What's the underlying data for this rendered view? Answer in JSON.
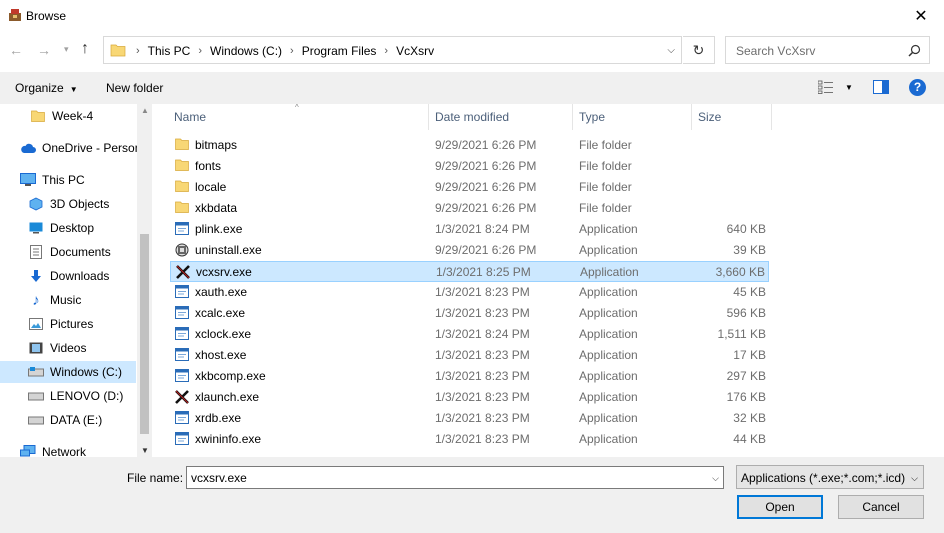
{
  "window": {
    "title": "Browse",
    "close_label": "✕"
  },
  "nav": {
    "address_crumbs": [
      "This PC",
      "Windows (C:)",
      "Program Files",
      "VcXsrv"
    ],
    "search_placeholder": "Search VcXsrv"
  },
  "toolbar": {
    "organize": "Organize",
    "new_folder": "New folder"
  },
  "sidebar": {
    "items": [
      {
        "label": "Week-4",
        "icon": "folder-icon"
      },
      {
        "label": "OneDrive - Person",
        "icon": "cloud-icon"
      },
      {
        "label": "This PC",
        "icon": "computer-icon"
      },
      {
        "label": "3D Objects",
        "icon": "cube-icon"
      },
      {
        "label": "Desktop",
        "icon": "desktop-icon"
      },
      {
        "label": "Documents",
        "icon": "documents-icon"
      },
      {
        "label": "Downloads",
        "icon": "download-icon"
      },
      {
        "label": "Music",
        "icon": "music-icon"
      },
      {
        "label": "Pictures",
        "icon": "pictures-icon"
      },
      {
        "label": "Videos",
        "icon": "videos-icon"
      },
      {
        "label": "Windows (C:)",
        "icon": "drive-icon"
      },
      {
        "label": "LENOVO (D:)",
        "icon": "drive-icon"
      },
      {
        "label": "DATA (E:)",
        "icon": "drive-icon"
      },
      {
        "label": "Network",
        "icon": "network-icon"
      }
    ]
  },
  "columns": {
    "name": "Name",
    "date": "Date modified",
    "type": "Type",
    "size": "Size"
  },
  "files": [
    {
      "name": "bitmaps",
      "date": "9/29/2021 6:26 PM",
      "type": "File folder",
      "size": "",
      "icon": "folder"
    },
    {
      "name": "fonts",
      "date": "9/29/2021 6:26 PM",
      "type": "File folder",
      "size": "",
      "icon": "folder"
    },
    {
      "name": "locale",
      "date": "9/29/2021 6:26 PM",
      "type": "File folder",
      "size": "",
      "icon": "folder"
    },
    {
      "name": "xkbdata",
      "date": "9/29/2021 6:26 PM",
      "type": "File folder",
      "size": "",
      "icon": "folder"
    },
    {
      "name": "plink.exe",
      "date": "1/3/2021 8:24 PM",
      "type": "Application",
      "size": "640 KB",
      "icon": "app"
    },
    {
      "name": "uninstall.exe",
      "date": "9/29/2021 6:26 PM",
      "type": "Application",
      "size": "39 KB",
      "icon": "uninstall"
    },
    {
      "name": "vcxsrv.exe",
      "date": "1/3/2021 8:25 PM",
      "type": "Application",
      "size": "3,660 KB",
      "icon": "x"
    },
    {
      "name": "xauth.exe",
      "date": "1/3/2021 8:23 PM",
      "type": "Application",
      "size": "45 KB",
      "icon": "app"
    },
    {
      "name": "xcalc.exe",
      "date": "1/3/2021 8:23 PM",
      "type": "Application",
      "size": "596 KB",
      "icon": "app"
    },
    {
      "name": "xclock.exe",
      "date": "1/3/2021 8:24 PM",
      "type": "Application",
      "size": "1,511 KB",
      "icon": "app"
    },
    {
      "name": "xhost.exe",
      "date": "1/3/2021 8:23 PM",
      "type": "Application",
      "size": "17 KB",
      "icon": "app"
    },
    {
      "name": "xkbcomp.exe",
      "date": "1/3/2021 8:23 PM",
      "type": "Application",
      "size": "297 KB",
      "icon": "app"
    },
    {
      "name": "xlaunch.exe",
      "date": "1/3/2021 8:23 PM",
      "type": "Application",
      "size": "176 KB",
      "icon": "x"
    },
    {
      "name": "xrdb.exe",
      "date": "1/3/2021 8:23 PM",
      "type": "Application",
      "size": "32 KB",
      "icon": "app"
    },
    {
      "name": "xwininfo.exe",
      "date": "1/3/2021 8:23 PM",
      "type": "Application",
      "size": "44 KB",
      "icon": "app"
    }
  ],
  "selected_file": "vcxsrv.exe",
  "bottom": {
    "file_name_label": "File name:",
    "file_name_value": "vcxsrv.exe",
    "file_type": "Applications (*.exe;*.com;*.icd)",
    "open_label": "Open",
    "cancel_label": "Cancel"
  },
  "colors": {
    "accent": "#0078d7",
    "selection": "#cce8ff",
    "folder": "#f8d775"
  }
}
